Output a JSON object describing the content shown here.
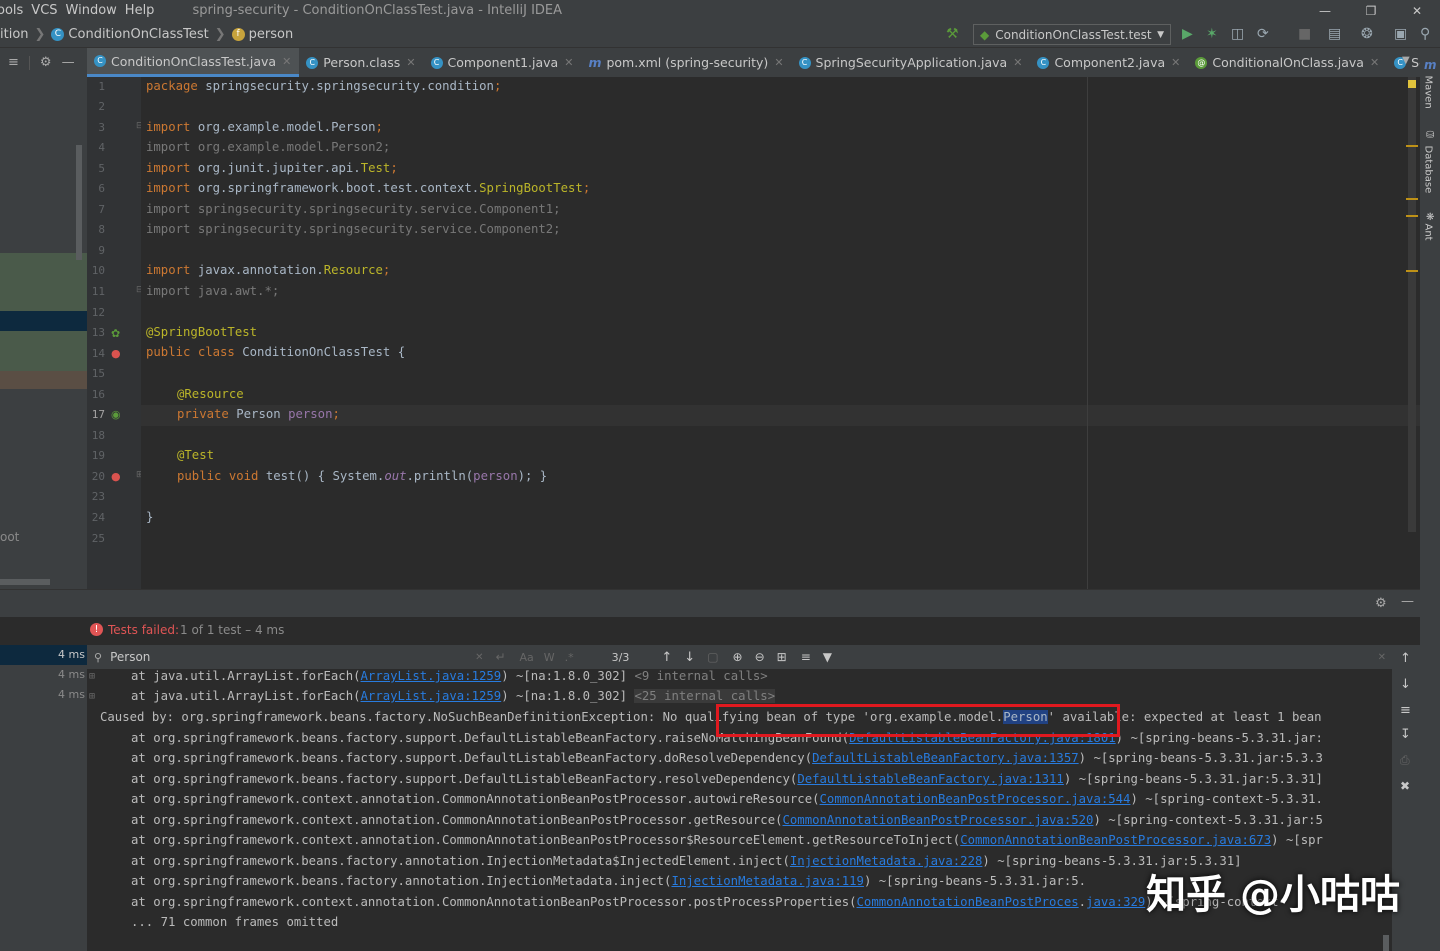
{
  "menubar": {
    "items": [
      "ools",
      "VCS",
      "Window",
      "Help"
    ],
    "window_title": "spring-security - ConditionOnClassTest.java - IntelliJ IDEA"
  },
  "navbar": {
    "crumbs": [
      "ition",
      "ConditionOnClassTest",
      "person"
    ],
    "run_config": "ConditionOnClassTest.test"
  },
  "tabs": [
    {
      "label": "ConditionOnClassTest.java",
      "icon": "test-class-icon",
      "color": "#3592c4"
    },
    {
      "label": "Person.class",
      "icon": "class-icon",
      "color": "#3592c4"
    },
    {
      "label": "Component1.java",
      "icon": "class-icon",
      "color": "#3592c4"
    },
    {
      "label": "pom.xml (spring-security)",
      "icon": "maven-icon",
      "color": "#5880c4"
    },
    {
      "label": "SpringSecurityApplication.java",
      "icon": "spring-class-icon",
      "color": "#3592c4"
    },
    {
      "label": "Component2.java",
      "icon": "class-icon",
      "color": "#3592c4"
    },
    {
      "label": "ConditionalOnClass.java",
      "icon": "annotation-icon",
      "color": "#5b9b3a"
    },
    {
      "label": "SecurityFilte",
      "icon": "class-icon",
      "color": "#3592c4"
    }
  ],
  "editor": {
    "line_numbers": [
      "1",
      "2",
      "3",
      "4",
      "5",
      "6",
      "7",
      "8",
      "9",
      "10",
      "11",
      "12",
      "13",
      "14",
      "15",
      "16",
      "17",
      "18",
      "19",
      "20",
      "23",
      "24",
      "25"
    ],
    "lines": {
      "l1a": "package ",
      "l1b": "springsecurity.springsecurity.condition",
      "l1c": ";",
      "l3a": "import ",
      "l3b": "org.example.model.Person",
      "l3c": ";",
      "l4": "import org.example.model.Person2;",
      "l5a": "import ",
      "l5b": "org.junit.jupiter.api.",
      "l5c": "Test",
      "l5d": ";",
      "l6a": "import ",
      "l6b": "org.springframework.boot.test.context.",
      "l6c": "SpringBootTest",
      "l6d": ";",
      "l7": "import springsecurity.springsecurity.service.Component1;",
      "l8": "import springsecurity.springsecurity.service.Component2;",
      "l10a": "import ",
      "l10b": "javax.annotation.",
      "l10c": "Resource",
      "l10d": ";",
      "l11a": "import ",
      "l11b": "java.awt.*",
      "l11c": ";",
      "l13": "@SpringBootTest",
      "l14a": "public class ",
      "l14b": "ConditionOnClassTest {",
      "l16": "@Resource",
      "l17a": "private ",
      "l17b": "Person ",
      "l17c": "person",
      "l17d": ";",
      "l19": "@Test",
      "l20a": "public void ",
      "l20b": "test() { System.",
      "l20c": "out",
      "l20d": ".println(",
      "l20e": "person",
      "l20f": "); }",
      "l24": "}"
    }
  },
  "test_status": {
    "label": "Tests failed:",
    "detail": "1 of 1 test – 4 ms"
  },
  "test_tree": {
    "times": [
      "4 ms",
      "4 ms",
      "4 ms"
    ],
    "root_fragment": "oot"
  },
  "findbar": {
    "query": "Person",
    "match_case": "Aa",
    "words": "W",
    "regex": ".*",
    "count": "3/3"
  },
  "console": {
    "l1a": "at java.util.ArrayList.forEach(",
    "l1b": "ArrayList.java:1259",
    "l1c": ") ~[na:1.8.0_302] ",
    "l1d": "<9 internal calls>",
    "l2a": "at java.util.ArrayList.forEach(",
    "l2b": "ArrayList.java:1259",
    "l2c": ") ~[na:1.8.0_302] ",
    "l2d": "<25 internal calls>",
    "l3a": "Caused by: org.springframework.beans.factory.NoSuchBeanDefinitionException: ",
    "l3b": "No qualifying bean of type 'org.example.model.",
    "l3c": "Person",
    "l3d": "' available: expected at least 1 bean",
    "l4a": "at org.springframework.beans.factory.support.DefaultListableBeanFactory.raiseNoMatchingBeanFound(",
    "l4b": "DefaultListableBeanFactory.java:1801",
    "l4c": ") ~[spring-beans-5.3.31.jar:",
    "l5a": "at org.springframework.beans.factory.support.DefaultListableBeanFactory.doResolveDependency(",
    "l5b": "DefaultListableBeanFactory.java:1357",
    "l5c": ") ~[spring-beans-5.3.31.jar:5.3.3",
    "l6a": "at org.springframework.beans.factory.support.DefaultListableBeanFactory.resolveDependency(",
    "l6b": "DefaultListableBeanFactory.java:1311",
    "l6c": ") ~[spring-beans-5.3.31.jar:5.3.31]",
    "l7a": "at org.springframework.context.annotation.CommonAnnotationBeanPostProcessor.autowireResource(",
    "l7b": "CommonAnnotationBeanPostProcessor.java:544",
    "l7c": ") ~[spring-context-5.3.31.",
    "l8a": "at org.springframework.context.annotation.CommonAnnotationBeanPostProcessor.getResource(",
    "l8b": "CommonAnnotationBeanPostProcessor.java:520",
    "l8c": ") ~[spring-context-5.3.31.jar:5",
    "l9a": "at org.springframework.context.annotation.CommonAnnotationBeanPostProcessor$ResourceElement.getResourceToInject(",
    "l9b": "CommonAnnotationBeanPostProcessor.java:673",
    "l9c": ") ~[spr",
    "l10a": "at org.springframework.beans.factory.annotation.InjectionMetadata$InjectedElement.inject(",
    "l10b": "InjectionMetadata.java:228",
    "l10c": ") ~[spring-beans-5.3.31.jar:5.3.31]",
    "l11a": "at org.springframework.beans.factory.annotation.InjectionMetadata.inject(",
    "l11b": "InjectionMetadata.java:119",
    "l11c": ") ~[spring-beans-5.3.31.jar:5.",
    "l12a": "at org.springframework.context.annotation.CommonAnnotationBeanPostProcessor.postProcessProperties(",
    "l12b": "CommonAnnotationBeanPostProces",
    "l12c": "java:329",
    "l12d": ") ~[spring-context-",
    "l13": "... 71 common frames omitted"
  },
  "rightbar": {
    "maven": "Maven",
    "database": "Database",
    "ant": "Ant"
  },
  "watermark": "知乎 @小咕咕",
  "colors": {
    "keyword": "#cc7832",
    "annotation": "#bbb529",
    "field": "#9876aa",
    "link": "#287bde",
    "highlight_box": "#e0191f",
    "selection": "#214283",
    "error": "#e05555"
  }
}
